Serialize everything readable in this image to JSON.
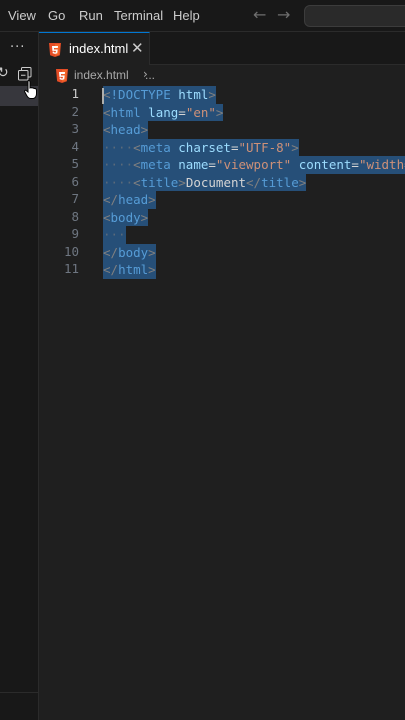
{
  "menu": {
    "items": [
      "View",
      "Go",
      "Run",
      "Terminal",
      "Help"
    ],
    "back_arrow": "←",
    "forward_arrow": "→"
  },
  "sidebar": {
    "more_label": "···",
    "refresh_glyph": "↻",
    "icons": [
      "more-actions-icon",
      "refresh-icon",
      "collapse-all-icon",
      "pointer-cursor-icon"
    ]
  },
  "tab": {
    "label": "index.html",
    "close_glyph": "✕",
    "icon": "html5-icon"
  },
  "breadcrumb": {
    "file": "index.html",
    "separator": "›",
    "ellipsis": "..."
  },
  "editor": {
    "active_line": 1,
    "line_numbers": [
      "1",
      "2",
      "3",
      "4",
      "5",
      "6",
      "7",
      "8",
      "9",
      "10",
      "11"
    ],
    "lines": [
      [
        {
          "t": "<",
          "c": "ang"
        },
        {
          "t": "!DOCTYPE",
          "c": "tag"
        },
        {
          "t": " ",
          "c": "txt"
        },
        {
          "t": "html",
          "c": "attr"
        },
        {
          "t": ">",
          "c": "ang"
        }
      ],
      [
        {
          "t": "<",
          "c": "ang"
        },
        {
          "t": "html",
          "c": "tag"
        },
        {
          "t": " ",
          "c": "txt"
        },
        {
          "t": "lang",
          "c": "attr"
        },
        {
          "t": "=",
          "c": "txt"
        },
        {
          "t": "\"en\"",
          "c": "str"
        },
        {
          "t": ">",
          "c": "ang"
        }
      ],
      [
        {
          "t": "<",
          "c": "ang"
        },
        {
          "t": "head",
          "c": "tag"
        },
        {
          "t": ">",
          "c": "ang"
        }
      ],
      [
        {
          "t": "····",
          "c": "ws"
        },
        {
          "t": "<",
          "c": "ang"
        },
        {
          "t": "meta",
          "c": "tag"
        },
        {
          "t": " ",
          "c": "txt"
        },
        {
          "t": "charset",
          "c": "attr"
        },
        {
          "t": "=",
          "c": "txt"
        },
        {
          "t": "\"UTF-8\"",
          "c": "str"
        },
        {
          "t": ">",
          "c": "ang"
        }
      ],
      [
        {
          "t": "····",
          "c": "ws"
        },
        {
          "t": "<",
          "c": "ang"
        },
        {
          "t": "meta",
          "c": "tag"
        },
        {
          "t": " ",
          "c": "txt"
        },
        {
          "t": "name",
          "c": "attr"
        },
        {
          "t": "=",
          "c": "txt"
        },
        {
          "t": "\"viewport\"",
          "c": "str"
        },
        {
          "t": " ",
          "c": "txt"
        },
        {
          "t": "content",
          "c": "attr"
        },
        {
          "t": "=",
          "c": "txt"
        },
        {
          "t": "\"width=de",
          "c": "str"
        }
      ],
      [
        {
          "t": "····",
          "c": "ws"
        },
        {
          "t": "<",
          "c": "ang"
        },
        {
          "t": "title",
          "c": "tag"
        },
        {
          "t": ">",
          "c": "ang"
        },
        {
          "t": "Document",
          "c": "txt"
        },
        {
          "t": "</",
          "c": "ang"
        },
        {
          "t": "title",
          "c": "tag"
        },
        {
          "t": ">",
          "c": "ang"
        }
      ],
      [
        {
          "t": "</",
          "c": "ang"
        },
        {
          "t": "head",
          "c": "tag"
        },
        {
          "t": ">",
          "c": "ang"
        }
      ],
      [
        {
          "t": "<",
          "c": "ang"
        },
        {
          "t": "body",
          "c": "tag"
        },
        {
          "t": ">",
          "c": "ang"
        }
      ],
      [
        {
          "t": "···",
          "c": "ws"
        }
      ],
      [
        {
          "t": "</",
          "c": "ang"
        },
        {
          "t": "body",
          "c": "tag"
        },
        {
          "t": ">",
          "c": "ang"
        }
      ],
      [
        {
          "t": "</",
          "c": "ang"
        },
        {
          "t": "html",
          "c": "tag"
        },
        {
          "t": ">",
          "c": "ang"
        }
      ]
    ]
  },
  "colors": {
    "background": "#1f1f1f",
    "chrome": "#181818",
    "selection": "#264f78",
    "accent": "#0078d4",
    "html5": "#e44d26"
  }
}
